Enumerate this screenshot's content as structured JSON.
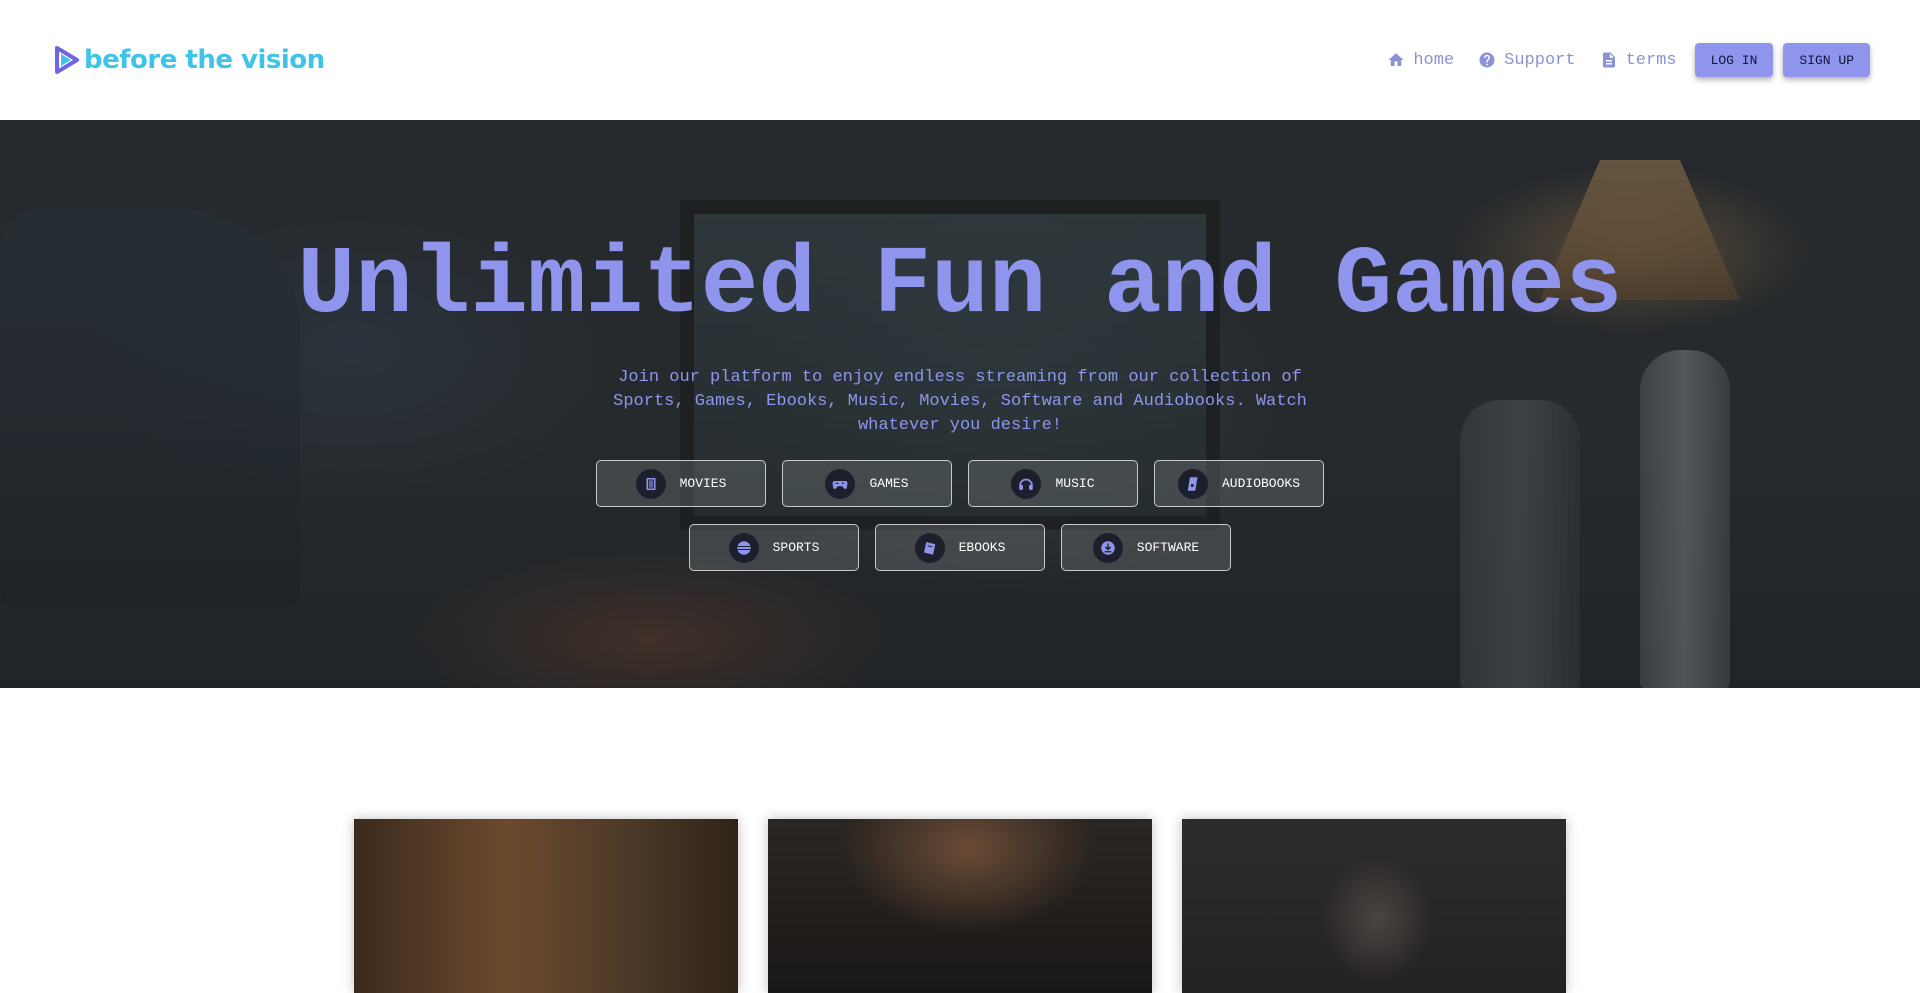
{
  "brand": {
    "name": "before the vision",
    "color": "#3fc3e6"
  },
  "nav": {
    "links": [
      {
        "label": "home",
        "icon": "home-icon"
      },
      {
        "label": "Support",
        "icon": "help-circle-icon"
      },
      {
        "label": "terms",
        "icon": "document-icon"
      }
    ],
    "login_label": "LOG IN",
    "signup_label": "SIGN UP"
  },
  "hero": {
    "title": "Unlimited Fun and Games",
    "subtitle": "Join our platform to enjoy endless streaming from our collection of Sports, Games, Ebooks, Music, Movies, Software and Audiobooks. Watch whatever you desire!",
    "categories": [
      {
        "label": "MOVIES",
        "icon": "film-icon"
      },
      {
        "label": "GAMES",
        "icon": "gamepad-icon"
      },
      {
        "label": "MUSIC",
        "icon": "headphones-icon"
      },
      {
        "label": "AUDIOBOOKS",
        "icon": "audiobook-icon"
      },
      {
        "label": "SPORTS",
        "icon": "ball-icon"
      },
      {
        "label": "EBOOKS",
        "icon": "ebook-icon"
      },
      {
        "label": "SOFTWARE",
        "icon": "download-icon"
      }
    ]
  },
  "colors": {
    "accent": "#8f95ec",
    "nav_text": "#8a93d6"
  }
}
